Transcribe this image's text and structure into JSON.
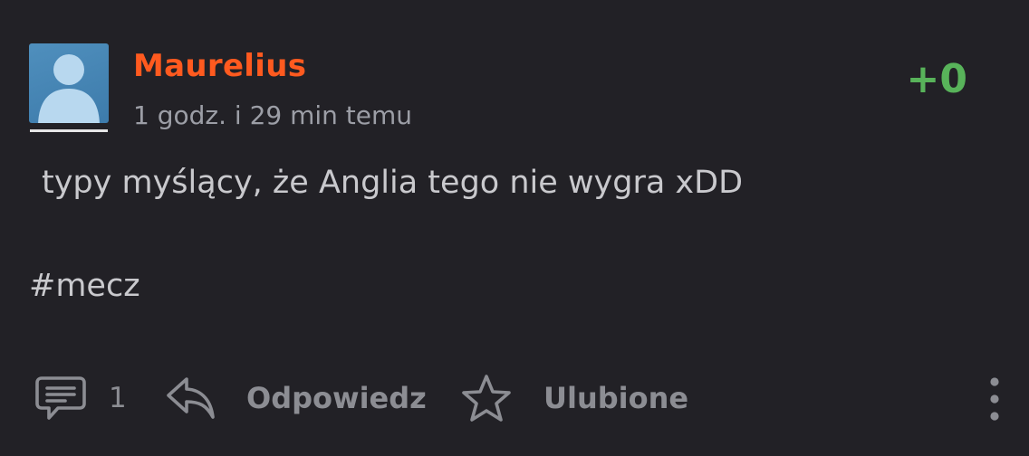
{
  "entry": {
    "author": "Maurelius",
    "timestamp": "1 godz. i 29 min temu",
    "vote_score": "+0",
    "body": "typy myślący, że Anglia tego nie wygra xDD",
    "tag": "#mecz"
  },
  "actions": {
    "comments_count": "1",
    "reply_label": "Odpowiedz",
    "favorite_label": "Ulubione"
  },
  "colors": {
    "background": "#222126",
    "author": "#ff5a1f",
    "vote_positive": "#58b35a",
    "muted": "#8c8d93"
  },
  "icons": {
    "avatar": "default-avatar-icon",
    "comments": "comment-bubble-icon",
    "reply": "reply-arrow-icon",
    "favorite": "star-icon",
    "more": "more-vertical-icon"
  }
}
